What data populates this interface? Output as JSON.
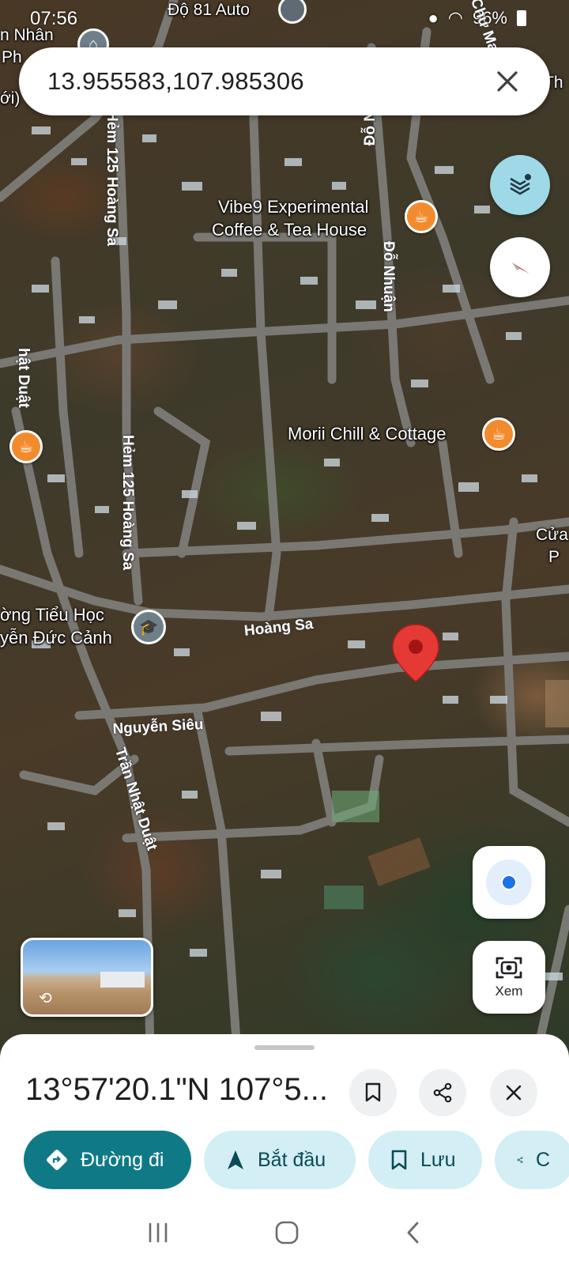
{
  "status": {
    "time": "07:56",
    "battery": "96%"
  },
  "search": {
    "query": "13.955583,107.985306"
  },
  "map": {
    "pois": [
      {
        "name": "Vibe9 Experimental",
        "name2": "Coffee & Tea House"
      },
      {
        "name": "Morii Chill & Cottage"
      },
      {
        "name": "ờng Tiểu Học",
        "name2": "yễn Đức Cảnh"
      }
    ],
    "top_labels": {
      "auto": "Độ 81 Auto",
      "nhan": "n Nhân",
      "ph": "Ph",
      "oi": "ới)",
      "chua": "Chư Mạ",
      "th": "Th",
      "cua": "Cửa",
      "p": "P"
    },
    "roads": {
      "hem1": "Hẻm 125 Hoàng Sa",
      "hem2": "Hẻm 125 Hoàng Sa",
      "do_nhuan": "Đỗ Nhuận",
      "do_n": "Đỗ N",
      "hoang_sa": "Hoàng Sa",
      "nguyen_sieu": "Nguyễn Siêu",
      "tran_nhat_duat": "Trần Nhật Duật",
      "nhat_duat": "hật Duật"
    }
  },
  "controls": {
    "lens_label": "Xem"
  },
  "sheet": {
    "title": "13°57'20.1\"N 107°5...",
    "actions": [
      {
        "label": "Đường đi",
        "icon": "directions-icon"
      },
      {
        "label": "Bắt đầu",
        "icon": "navigation-arrow-icon"
      },
      {
        "label": "Lưu",
        "icon": "bookmark-icon"
      },
      {
        "label": "C",
        "icon": "share-icon"
      }
    ]
  },
  "colors": {
    "accent": "#0f7a86",
    "chip": "#d3eef5",
    "pin": "#e53935",
    "poi": "#f28b2e",
    "location": "#1a73e8"
  }
}
